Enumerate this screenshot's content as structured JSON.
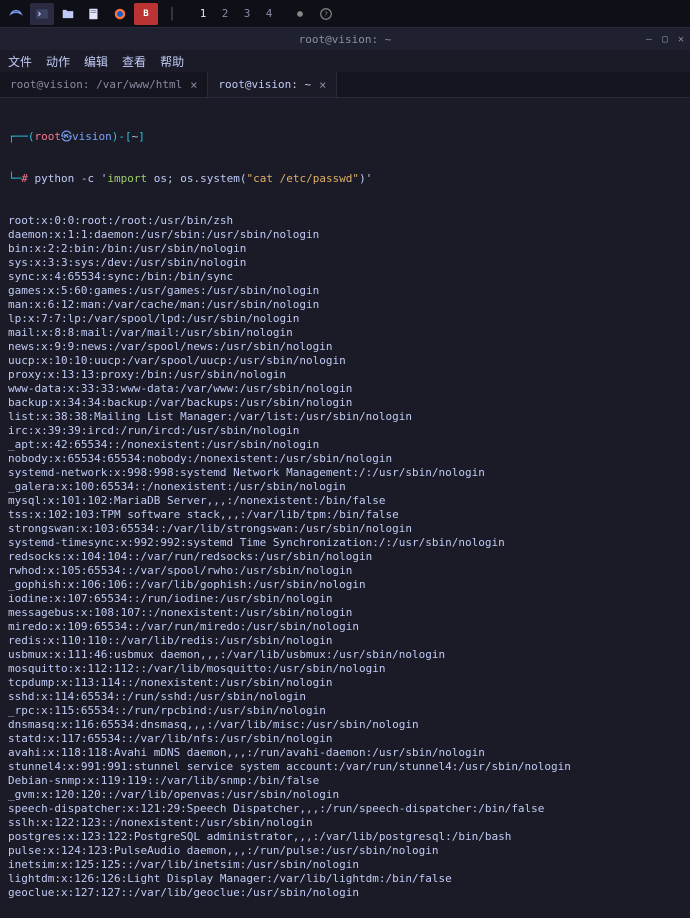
{
  "taskbar": {
    "workspaces": [
      "1",
      "2",
      "3",
      "4"
    ]
  },
  "window": {
    "title": "root@vision: ~"
  },
  "menu": {
    "items": [
      "文件",
      "动作",
      "编辑",
      "查看",
      "帮助"
    ]
  },
  "tabs": [
    {
      "label": "root@vision: /var/www/html",
      "active": false
    },
    {
      "label": "root@vision: ~",
      "active": true
    }
  ],
  "prompt": {
    "open": "┌──(",
    "user": "root",
    "at": "㉿",
    "host": "vision",
    "close": ")-[",
    "path": "~",
    "end": "]",
    "line2_prefix": "└─",
    "arrow": "# "
  },
  "command": {
    "bin": "python",
    "flag": "-c",
    "code_prefix": "'",
    "code_import": "import",
    "code_rest": " os; os.system(",
    "code_str": "\"cat /etc/passwd\"",
    "code_suffix": ")'"
  },
  "output": [
    "root:x:0:0:root:/root:/usr/bin/zsh",
    "daemon:x:1:1:daemon:/usr/sbin:/usr/sbin/nologin",
    "bin:x:2:2:bin:/bin:/usr/sbin/nologin",
    "sys:x:3:3:sys:/dev:/usr/sbin/nologin",
    "sync:x:4:65534:sync:/bin:/bin/sync",
    "games:x:5:60:games:/usr/games:/usr/sbin/nologin",
    "man:x:6:12:man:/var/cache/man:/usr/sbin/nologin",
    "lp:x:7:7:lp:/var/spool/lpd:/usr/sbin/nologin",
    "mail:x:8:8:mail:/var/mail:/usr/sbin/nologin",
    "news:x:9:9:news:/var/spool/news:/usr/sbin/nologin",
    "uucp:x:10:10:uucp:/var/spool/uucp:/usr/sbin/nologin",
    "proxy:x:13:13:proxy:/bin:/usr/sbin/nologin",
    "www-data:x:33:33:www-data:/var/www:/usr/sbin/nologin",
    "backup:x:34:34:backup:/var/backups:/usr/sbin/nologin",
    "list:x:38:38:Mailing List Manager:/var/list:/usr/sbin/nologin",
    "irc:x:39:39:ircd:/run/ircd:/usr/sbin/nologin",
    "_apt:x:42:65534::/nonexistent:/usr/sbin/nologin",
    "nobody:x:65534:65534:nobody:/nonexistent:/usr/sbin/nologin",
    "systemd-network:x:998:998:systemd Network Management:/:/usr/sbin/nologin",
    "_galera:x:100:65534::/nonexistent:/usr/sbin/nologin",
    "mysql:x:101:102:MariaDB Server,,,:/nonexistent:/bin/false",
    "tss:x:102:103:TPM software stack,,,:/var/lib/tpm:/bin/false",
    "strongswan:x:103:65534::/var/lib/strongswan:/usr/sbin/nologin",
    "systemd-timesync:x:992:992:systemd Time Synchronization:/:/usr/sbin/nologin",
    "redsocks:x:104:104::/var/run/redsocks:/usr/sbin/nologin",
    "rwhod:x:105:65534::/var/spool/rwho:/usr/sbin/nologin",
    "_gophish:x:106:106::/var/lib/gophish:/usr/sbin/nologin",
    "iodine:x:107:65534::/run/iodine:/usr/sbin/nologin",
    "messagebus:x:108:107::/nonexistent:/usr/sbin/nologin",
    "miredo:x:109:65534::/var/run/miredo:/usr/sbin/nologin",
    "redis:x:110:110::/var/lib/redis:/usr/sbin/nologin",
    "usbmux:x:111:46:usbmux daemon,,,:/var/lib/usbmux:/usr/sbin/nologin",
    "mosquitto:x:112:112::/var/lib/mosquitto:/usr/sbin/nologin",
    "tcpdump:x:113:114::/nonexistent:/usr/sbin/nologin",
    "sshd:x:114:65534::/run/sshd:/usr/sbin/nologin",
    "_rpc:x:115:65534::/run/rpcbind:/usr/sbin/nologin",
    "dnsmasq:x:116:65534:dnsmasq,,,:/var/lib/misc:/usr/sbin/nologin",
    "statd:x:117:65534::/var/lib/nfs:/usr/sbin/nologin",
    "avahi:x:118:118:Avahi mDNS daemon,,,:/run/avahi-daemon:/usr/sbin/nologin",
    "stunnel4:x:991:991:stunnel service system account:/var/run/stunnel4:/usr/sbin/nologin",
    "Debian-snmp:x:119:119::/var/lib/snmp:/bin/false",
    "_gvm:x:120:120::/var/lib/openvas:/usr/sbin/nologin",
    "speech-dispatcher:x:121:29:Speech Dispatcher,,,:/run/speech-dispatcher:/bin/false",
    "sslh:x:122:123::/nonexistent:/usr/sbin/nologin",
    "postgres:x:123:122:PostgreSQL administrator,,,:/var/lib/postgresql:/bin/bash",
    "pulse:x:124:123:PulseAudio daemon,,,:/run/pulse:/usr/sbin/nologin",
    "inetsim:x:125:125::/var/lib/inetsim:/usr/sbin/nologin",
    "lightdm:x:126:126:Light Display Manager:/var/lib/lightdm:/bin/false",
    "geoclue:x:127:127::/var/lib/geoclue:/usr/sbin/nologin"
  ]
}
